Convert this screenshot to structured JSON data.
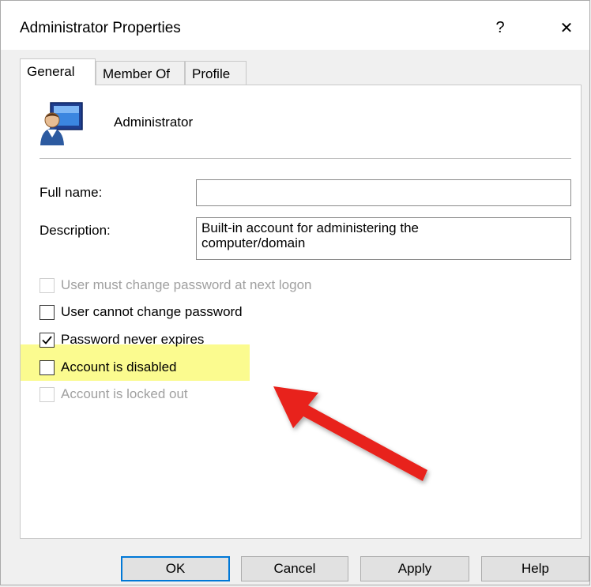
{
  "window": {
    "title": "Administrator Properties",
    "help_glyph": "?",
    "close_glyph": "✕"
  },
  "tabs": [
    {
      "label": "General",
      "active": true
    },
    {
      "label": "Member Of",
      "active": false
    },
    {
      "label": "Profile",
      "active": false
    }
  ],
  "general": {
    "user_name": "Administrator",
    "user_icon": "user-computer-icon",
    "full_name": {
      "label": "Full name:",
      "value": ""
    },
    "description": {
      "label": "Description:",
      "value": "Built-in account for administering the\ncomputer/domain"
    },
    "checkboxes": [
      {
        "label": "User must change password at next logon",
        "checked": false,
        "enabled": false
      },
      {
        "label": "User cannot change password",
        "checked": false,
        "enabled": true
      },
      {
        "label": "Password never expires",
        "checked": true,
        "enabled": true
      },
      {
        "label": "Account is disabled",
        "checked": false,
        "enabled": true,
        "highlighted": true
      },
      {
        "label": "Account is locked out",
        "checked": false,
        "enabled": false
      }
    ]
  },
  "annotation": {
    "type": "arrow-icon",
    "color": "#e8231a",
    "highlight_color": "#fbfb8f"
  },
  "buttons": {
    "ok": "OK",
    "cancel": "Cancel",
    "apply": "Apply",
    "help": "Help"
  }
}
